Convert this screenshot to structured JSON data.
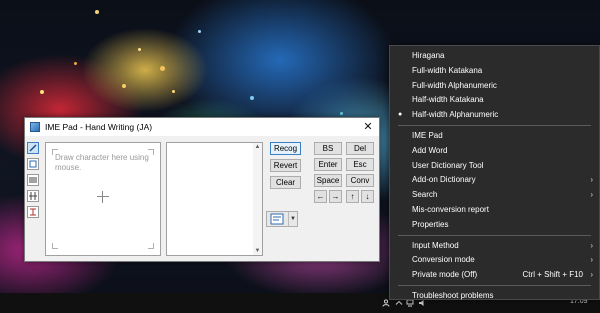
{
  "imepad": {
    "title": "IME Pad - Hand Writing (JA)",
    "draw_hint": "Draw character here using mouse.",
    "buttons": {
      "recog": "Recog",
      "revert": "Revert",
      "clear": "Clear",
      "bs": "BS",
      "del": "Del",
      "enter": "Enter",
      "esc": "Esc",
      "space": "Space",
      "conv": "Conv",
      "left": "←",
      "right": "→",
      "up": "↑",
      "down": "↓"
    }
  },
  "menu": {
    "input_modes": [
      {
        "label": "Hiragana",
        "selected": false
      },
      {
        "label": "Full-width Katakana",
        "selected": false
      },
      {
        "label": "Full-width Alphanumeric",
        "selected": false
      },
      {
        "label": "Half-width Katakana",
        "selected": false
      },
      {
        "label": "Half-width Alphanumeric",
        "selected": true
      }
    ],
    "tools": [
      {
        "label": "IME Pad",
        "submenu": false
      },
      {
        "label": "Add Word",
        "submenu": false
      },
      {
        "label": "User Dictionary Tool",
        "submenu": false
      },
      {
        "label": "Add-on Dictionary",
        "submenu": true
      },
      {
        "label": "Search",
        "submenu": true
      },
      {
        "label": "Mis-conversion report",
        "submenu": false
      },
      {
        "label": "Properties",
        "submenu": false
      }
    ],
    "settings": [
      {
        "label": "Input Method",
        "shortcut": "",
        "submenu": true
      },
      {
        "label": "Conversion mode",
        "shortcut": "",
        "submenu": true
      },
      {
        "label": "Private mode (Off)",
        "shortcut": "Ctrl + Shift + F10",
        "submenu": true
      }
    ],
    "troubleshoot": "Troubleshoot problems",
    "selected_marker": "●",
    "chevron": "›"
  },
  "taskbar": {
    "clock": "17:09"
  },
  "colors": {
    "menu_bg": "#2b2b2b",
    "menu_text": "#ffffff",
    "window_bg": "#f0f0f0",
    "accent": "#3a80c9"
  }
}
